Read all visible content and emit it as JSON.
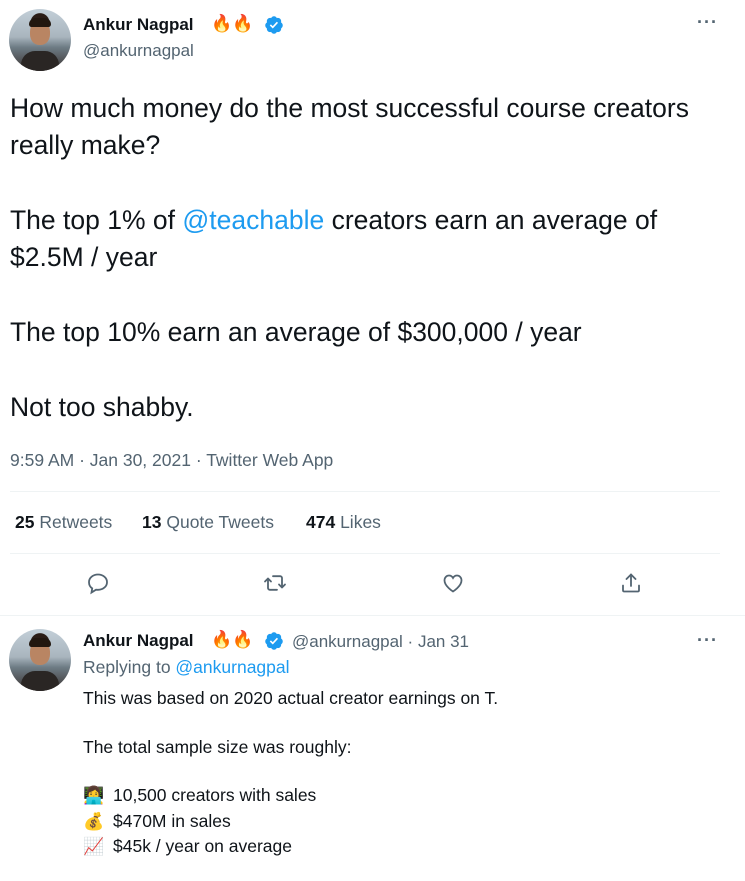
{
  "main_tweet": {
    "author_name": "Ankur Nagpal",
    "name_emoji": "🔥🔥",
    "handle": "@ankurnagpal",
    "paragraph_1": "How much money do the most successful course creators really make?",
    "paragraph_2_before": "The top 1% of ",
    "paragraph_2_mention": "@teachable",
    "paragraph_2_after": " creators earn an average of $2.5M / year",
    "paragraph_3": "The top 10% earn an average of $300,000 / year",
    "paragraph_4": "Not too shabby.",
    "timestamp": "9:59 AM · Jan 30, 2021 · Twitter Web App",
    "stats": {
      "retweets_count": "25",
      "retweets_label": "Retweets",
      "quote_count": "13",
      "quote_label": "Quote Tweets",
      "likes_count": "474",
      "likes_label": "Likes"
    },
    "actions": [
      "reply-icon",
      "retweet-icon",
      "like-icon",
      "share-icon"
    ]
  },
  "reply_tweet": {
    "author_name": "Ankur Nagpal",
    "name_emoji": "🔥🔥",
    "handle_date": "@ankurnagpal · Jan 31",
    "replying_prefix": "Replying to ",
    "replying_handle": "@ankurnagpal",
    "line_1": "This was based on 2020 actual creator earnings on T.",
    "line_2": "The total sample size was roughly:",
    "bullets": [
      {
        "icon": "👩‍💻",
        "text": "10,500 creators with sales"
      },
      {
        "icon": "💰",
        "text": "$470M in sales"
      },
      {
        "icon": "📈",
        "text": "$45k / year on average"
      }
    ]
  },
  "colors": {
    "accent": "#1d9bf0",
    "secondary_text": "#536471",
    "divider": "#eff3f4"
  }
}
